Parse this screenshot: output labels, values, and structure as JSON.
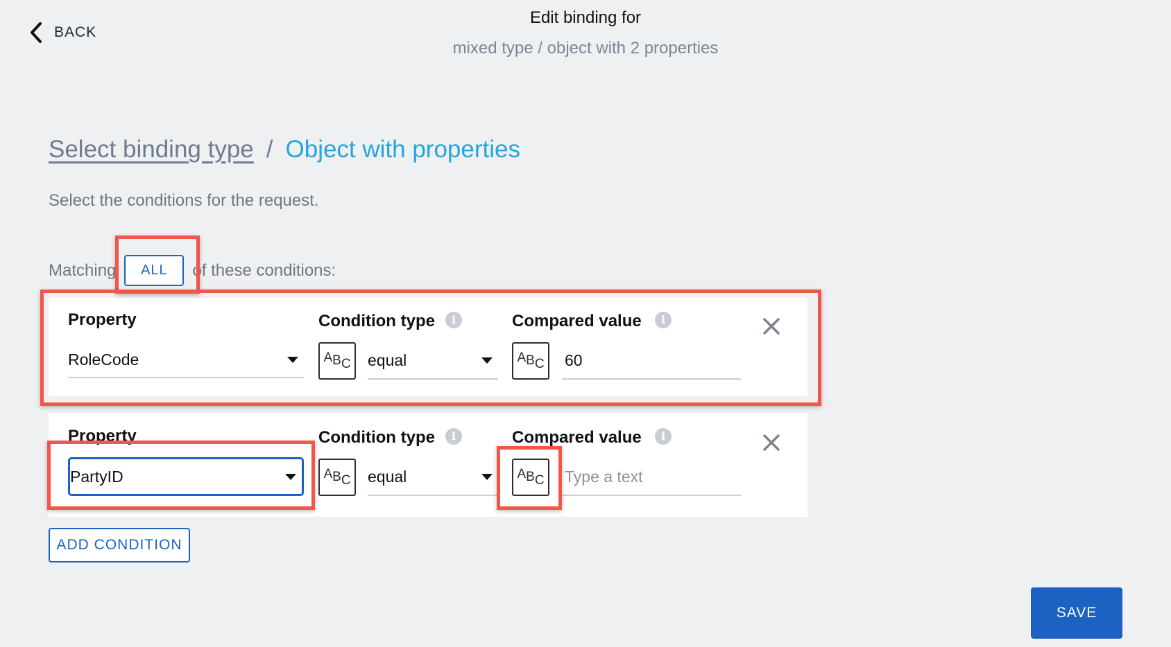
{
  "header": {
    "back_label": "BACK",
    "title": "Edit binding for",
    "subtitle": "mixed type / object with 2 properties"
  },
  "breadcrumb": {
    "link": "Select binding type",
    "separator": "/",
    "current": "Object with properties"
  },
  "description": "Select the conditions for the request.",
  "matching": {
    "prefix": "Matching",
    "mode": "ALL",
    "suffix": "of these conditions:"
  },
  "conditions": [
    {
      "property_label": "Property",
      "property_value": "RoleCode",
      "condition_type_label": "Condition type",
      "type_icon": "ABC",
      "condition_value": "equal",
      "compared_value_label": "Compared value",
      "compared_icon": "ABC",
      "compared_value": "60",
      "compared_placeholder": ""
    },
    {
      "property_label": "Property",
      "property_value": "PartyID",
      "condition_type_label": "Condition type",
      "type_icon": "ABC",
      "condition_value": "equal",
      "compared_value_label": "Compared value",
      "compared_icon": "ABC",
      "compared_value": "",
      "compared_placeholder": "Type a text"
    }
  ],
  "icons": {
    "back": "chevron-left-icon",
    "info": "info-icon",
    "close": "close-icon",
    "caret": "caret-down-icon",
    "text_type": "text-type-icon"
  },
  "buttons": {
    "add_condition": "ADD CONDITION",
    "save": "SAVE"
  },
  "colors": {
    "accent": "#1c62c3",
    "link_current": "#25a4de",
    "highlight": "#f2554a",
    "background": "#eff0f2"
  }
}
